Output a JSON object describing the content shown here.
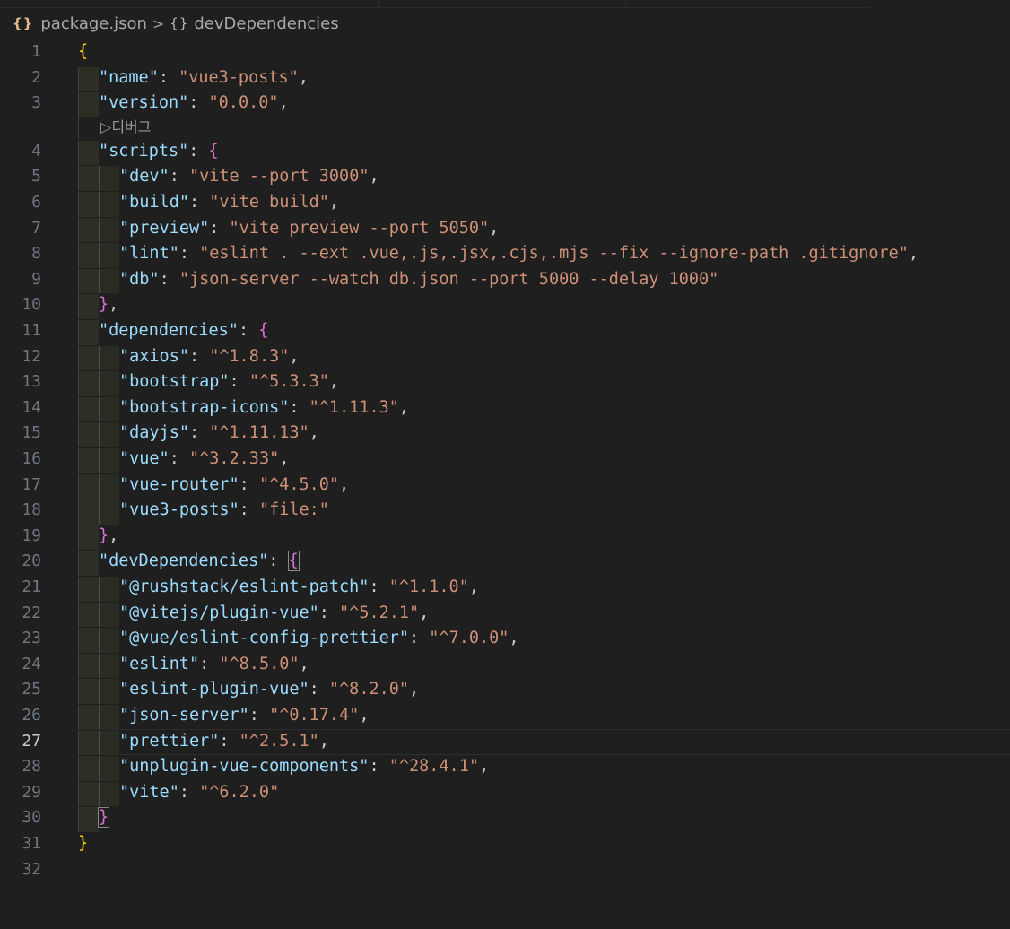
{
  "breadcrumb": {
    "file_icon": "{}",
    "file": "package.json",
    "separator": ">",
    "symbol_icon": "{}",
    "symbol": "devDependencies"
  },
  "codelens": {
    "glyph": "▷",
    "label": "디버그"
  },
  "current_line": 27,
  "lines": [
    {
      "n": "1",
      "indent": 0,
      "parts": [
        {
          "c": "b1",
          "t": "{"
        }
      ]
    },
    {
      "n": "2",
      "indent": 1,
      "parts": [
        {
          "c": "key",
          "t": "\"name\""
        },
        {
          "c": "p",
          "t": ": "
        },
        {
          "c": "str",
          "t": "\"vue3-posts\""
        },
        {
          "c": "p",
          "t": ","
        }
      ]
    },
    {
      "n": "3",
      "indent": 1,
      "parts": [
        {
          "c": "key",
          "t": "\"version\""
        },
        {
          "c": "p",
          "t": ": "
        },
        {
          "c": "str",
          "t": "\"0.0.0\""
        },
        {
          "c": "p",
          "t": ","
        }
      ]
    },
    {
      "n": "4",
      "indent": 1,
      "parts": [
        {
          "c": "key",
          "t": "\"scripts\""
        },
        {
          "c": "p",
          "t": ": "
        },
        {
          "c": "b2",
          "t": "{"
        }
      ]
    },
    {
      "n": "5",
      "indent": 2,
      "parts": [
        {
          "c": "key",
          "t": "\"dev\""
        },
        {
          "c": "p",
          "t": ": "
        },
        {
          "c": "str",
          "t": "\"vite --port 3000\""
        },
        {
          "c": "p",
          "t": ","
        }
      ]
    },
    {
      "n": "6",
      "indent": 2,
      "parts": [
        {
          "c": "key",
          "t": "\"build\""
        },
        {
          "c": "p",
          "t": ": "
        },
        {
          "c": "str",
          "t": "\"vite build\""
        },
        {
          "c": "p",
          "t": ","
        }
      ]
    },
    {
      "n": "7",
      "indent": 2,
      "parts": [
        {
          "c": "key",
          "t": "\"preview\""
        },
        {
          "c": "p",
          "t": ": "
        },
        {
          "c": "str",
          "t": "\"vite preview --port 5050\""
        },
        {
          "c": "p",
          "t": ","
        }
      ]
    },
    {
      "n": "8",
      "indent": 2,
      "parts": [
        {
          "c": "key",
          "t": "\"lint\""
        },
        {
          "c": "p",
          "t": ": "
        },
        {
          "c": "str",
          "t": "\"eslint . --ext .vue,.js,.jsx,.cjs,.mjs --fix --ignore-path .gitignore\""
        },
        {
          "c": "p",
          "t": ","
        }
      ]
    },
    {
      "n": "9",
      "indent": 2,
      "parts": [
        {
          "c": "key",
          "t": "\"db\""
        },
        {
          "c": "p",
          "t": ": "
        },
        {
          "c": "str",
          "t": "\"json-server --watch db.json --port 5000 --delay 1000\""
        }
      ]
    },
    {
      "n": "10",
      "indent": 1,
      "parts": [
        {
          "c": "b2",
          "t": "}"
        },
        {
          "c": "p",
          "t": ","
        }
      ]
    },
    {
      "n": "11",
      "indent": 1,
      "parts": [
        {
          "c": "key",
          "t": "\"dependencies\""
        },
        {
          "c": "p",
          "t": ": "
        },
        {
          "c": "b2",
          "t": "{"
        }
      ]
    },
    {
      "n": "12",
      "indent": 2,
      "parts": [
        {
          "c": "key",
          "t": "\"axios\""
        },
        {
          "c": "p",
          "t": ": "
        },
        {
          "c": "str",
          "t": "\"^1.8.3\""
        },
        {
          "c": "p",
          "t": ","
        }
      ]
    },
    {
      "n": "13",
      "indent": 2,
      "parts": [
        {
          "c": "key",
          "t": "\"bootstrap\""
        },
        {
          "c": "p",
          "t": ": "
        },
        {
          "c": "str",
          "t": "\"^5.3.3\""
        },
        {
          "c": "p",
          "t": ","
        }
      ]
    },
    {
      "n": "14",
      "indent": 2,
      "parts": [
        {
          "c": "key",
          "t": "\"bootstrap-icons\""
        },
        {
          "c": "p",
          "t": ": "
        },
        {
          "c": "str",
          "t": "\"^1.11.3\""
        },
        {
          "c": "p",
          "t": ","
        }
      ]
    },
    {
      "n": "15",
      "indent": 2,
      "parts": [
        {
          "c": "key",
          "t": "\"dayjs\""
        },
        {
          "c": "p",
          "t": ": "
        },
        {
          "c": "str",
          "t": "\"^1.11.13\""
        },
        {
          "c": "p",
          "t": ","
        }
      ]
    },
    {
      "n": "16",
      "indent": 2,
      "parts": [
        {
          "c": "key",
          "t": "\"vue\""
        },
        {
          "c": "p",
          "t": ": "
        },
        {
          "c": "str",
          "t": "\"^3.2.33\""
        },
        {
          "c": "p",
          "t": ","
        }
      ]
    },
    {
      "n": "17",
      "indent": 2,
      "parts": [
        {
          "c": "key",
          "t": "\"vue-router\""
        },
        {
          "c": "p",
          "t": ": "
        },
        {
          "c": "str",
          "t": "\"^4.5.0\""
        },
        {
          "c": "p",
          "t": ","
        }
      ]
    },
    {
      "n": "18",
      "indent": 2,
      "parts": [
        {
          "c": "key",
          "t": "\"vue3-posts\""
        },
        {
          "c": "p",
          "t": ": "
        },
        {
          "c": "str",
          "t": "\"file:\""
        }
      ]
    },
    {
      "n": "19",
      "indent": 1,
      "parts": [
        {
          "c": "b2",
          "t": "}"
        },
        {
          "c": "p",
          "t": ","
        }
      ]
    },
    {
      "n": "20",
      "indent": 1,
      "parts": [
        {
          "c": "key",
          "t": "\"devDependencies\""
        },
        {
          "c": "p",
          "t": ": "
        },
        {
          "c": "b2 bm",
          "t": "{"
        }
      ]
    },
    {
      "n": "21",
      "indent": 2,
      "parts": [
        {
          "c": "key",
          "t": "\"@rushstack/eslint-patch\""
        },
        {
          "c": "p",
          "t": ": "
        },
        {
          "c": "str",
          "t": "\"^1.1.0\""
        },
        {
          "c": "p",
          "t": ","
        }
      ]
    },
    {
      "n": "22",
      "indent": 2,
      "parts": [
        {
          "c": "key",
          "t": "\"@vitejs/plugin-vue\""
        },
        {
          "c": "p",
          "t": ": "
        },
        {
          "c": "str",
          "t": "\"^5.2.1\""
        },
        {
          "c": "p",
          "t": ","
        }
      ]
    },
    {
      "n": "23",
      "indent": 2,
      "parts": [
        {
          "c": "key",
          "t": "\"@vue/eslint-config-prettier\""
        },
        {
          "c": "p",
          "t": ": "
        },
        {
          "c": "str",
          "t": "\"^7.0.0\""
        },
        {
          "c": "p",
          "t": ","
        }
      ]
    },
    {
      "n": "24",
      "indent": 2,
      "parts": [
        {
          "c": "key",
          "t": "\"eslint\""
        },
        {
          "c": "p",
          "t": ": "
        },
        {
          "c": "str",
          "t": "\"^8.5.0\""
        },
        {
          "c": "p",
          "t": ","
        }
      ]
    },
    {
      "n": "25",
      "indent": 2,
      "parts": [
        {
          "c": "key",
          "t": "\"eslint-plugin-vue\""
        },
        {
          "c": "p",
          "t": ": "
        },
        {
          "c": "str",
          "t": "\"^8.2.0\""
        },
        {
          "c": "p",
          "t": ","
        }
      ]
    },
    {
      "n": "26",
      "indent": 2,
      "parts": [
        {
          "c": "key",
          "t": "\"json-server\""
        },
        {
          "c": "p",
          "t": ": "
        },
        {
          "c": "str",
          "t": "\"^0.17.4\""
        },
        {
          "c": "p",
          "t": ","
        }
      ]
    },
    {
      "n": "27",
      "indent": 2,
      "parts": [
        {
          "c": "key",
          "t": "\"prettier\""
        },
        {
          "c": "p",
          "t": ": "
        },
        {
          "c": "str",
          "t": "\"^2.5.1\""
        },
        {
          "c": "p",
          "t": ","
        }
      ]
    },
    {
      "n": "28",
      "indent": 2,
      "parts": [
        {
          "c": "key",
          "t": "\"unplugin-vue-components\""
        },
        {
          "c": "p",
          "t": ": "
        },
        {
          "c": "str",
          "t": "\"^28.4.1\""
        },
        {
          "c": "p",
          "t": ","
        }
      ]
    },
    {
      "n": "29",
      "indent": 2,
      "parts": [
        {
          "c": "key",
          "t": "\"vite\""
        },
        {
          "c": "p",
          "t": ": "
        },
        {
          "c": "str",
          "t": "\"^6.2.0\""
        }
      ]
    },
    {
      "n": "30",
      "indent": 1,
      "parts": [
        {
          "c": "b2 bm",
          "t": "}"
        }
      ]
    },
    {
      "n": "31",
      "indent": 0,
      "parts": [
        {
          "c": "b1",
          "t": "}"
        }
      ]
    },
    {
      "n": "32",
      "indent": 0,
      "parts": []
    }
  ]
}
